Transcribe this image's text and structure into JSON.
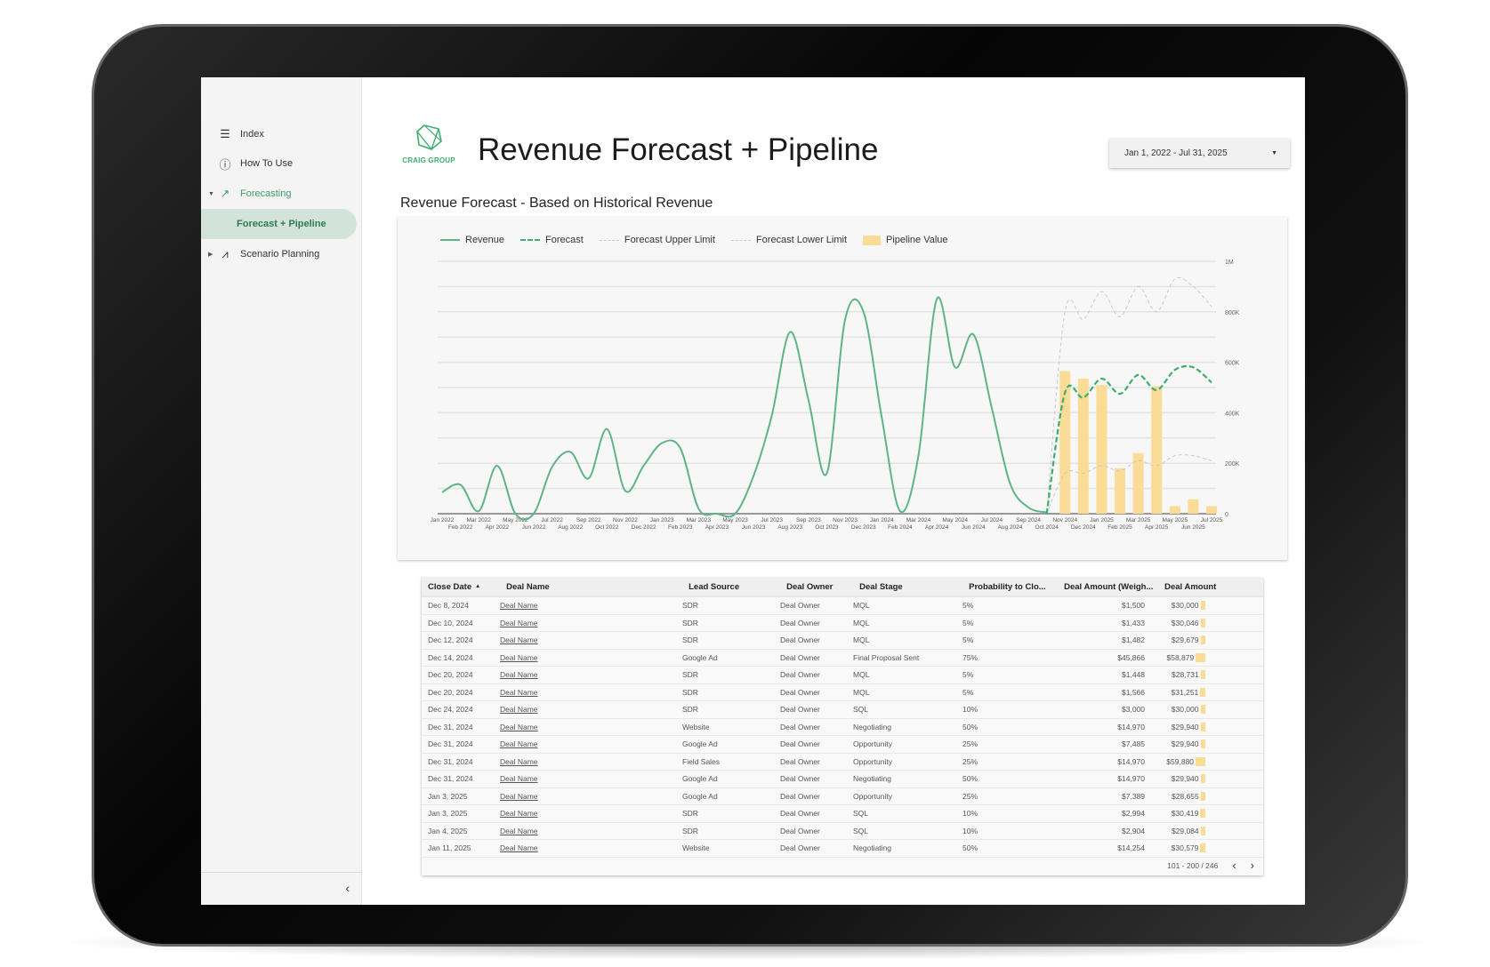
{
  "sidebar": {
    "items": [
      {
        "label": "Index",
        "icon": "list-icon"
      },
      {
        "label": "How To Use",
        "icon": "info-icon"
      },
      {
        "label": "Forecasting",
        "icon": "trending-up-icon",
        "expanded": true
      },
      {
        "label": "Forecast + Pipeline",
        "active": true
      },
      {
        "label": "Scenario Planning",
        "icon": "scatter-trend-icon",
        "expanded": false
      }
    ],
    "collapse_icon": "chevron-left-icon"
  },
  "header": {
    "logo_text": "CRAIG GROUP",
    "title": "Revenue Forecast + Pipeline",
    "date_range": "Jan 1, 2022 - Jul 31, 2025"
  },
  "colors": {
    "revenue": "#5fb487",
    "forecast": "#3fae6c",
    "limits": "#c8c8c8",
    "pipeline": "#fbdc97",
    "active_nav": "#d2e3d9"
  },
  "chart_data": {
    "type": "line",
    "title": "Revenue Forecast - Based on Historical Revenue",
    "legend_position": "top-left",
    "grid": true,
    "ylim": [
      0,
      1000000
    ],
    "yticks": [
      "0",
      "200K",
      "400K",
      "600K",
      "800K",
      "1M"
    ],
    "ytick_values": [
      0,
      200000,
      400000,
      600000,
      800000,
      1000000
    ],
    "categories": [
      "Jan 2022",
      "Feb 2022",
      "Mar 2022",
      "Apr 2022",
      "May 2022",
      "Jun 2022",
      "Jul 2022",
      "Aug 2022",
      "Sep 2022",
      "Oct 2022",
      "Nov 2022",
      "Dec 2022",
      "Jan 2023",
      "Feb 2023",
      "Mar 2023",
      "Apr 2023",
      "May 2023",
      "Jun 2023",
      "Jul 2023",
      "Aug 2023",
      "Sep 2023",
      "Oct 2023",
      "Nov 2023",
      "Dec 2023",
      "Jan 2024",
      "Feb 2024",
      "Mar 2024",
      "Apr 2024",
      "May 2024",
      "Jun 2024",
      "Jul 2024",
      "Aug 2024",
      "Sep 2024",
      "Oct 2024",
      "Nov 2024",
      "Dec 2024",
      "Jan 2025",
      "Feb 2025",
      "Mar 2025",
      "Apr 2025",
      "May 2025",
      "Jun 2025",
      "Jul 2025"
    ],
    "series": [
      {
        "name": "Revenue",
        "style": "solid",
        "values": [
          85000,
          115000,
          10000,
          190000,
          0,
          0,
          185000,
          245000,
          140000,
          335000,
          90000,
          190000,
          280000,
          260000,
          20000,
          0,
          0,
          150000,
          390000,
          720000,
          450000,
          160000,
          770000,
          800000,
          380000,
          10000,
          230000,
          850000,
          580000,
          710000,
          420000,
          120000,
          25000,
          5000,
          null,
          null,
          null,
          null,
          null,
          null,
          null,
          null,
          null
        ]
      },
      {
        "name": "Forecast",
        "style": "dashed",
        "values": [
          null,
          null,
          null,
          null,
          null,
          null,
          null,
          null,
          null,
          null,
          null,
          null,
          null,
          null,
          null,
          null,
          null,
          null,
          null,
          null,
          null,
          null,
          null,
          null,
          null,
          null,
          null,
          null,
          null,
          null,
          null,
          null,
          null,
          0,
          480000,
          460000,
          535000,
          475000,
          550000,
          490000,
          570000,
          580000,
          520000
        ]
      },
      {
        "name": "Forecast Upper Limit",
        "style": "dashed-gray",
        "values": [
          null,
          null,
          null,
          null,
          null,
          null,
          null,
          null,
          null,
          null,
          null,
          null,
          null,
          null,
          null,
          null,
          null,
          null,
          null,
          null,
          null,
          null,
          null,
          null,
          null,
          null,
          null,
          null,
          null,
          null,
          null,
          null,
          null,
          0,
          800000,
          770000,
          880000,
          780000,
          900000,
          800000,
          930000,
          900000,
          820000
        ]
      },
      {
        "name": "Forecast Lower Limit",
        "style": "dashed-gray",
        "values": [
          null,
          null,
          null,
          null,
          null,
          null,
          null,
          null,
          null,
          null,
          null,
          null,
          null,
          null,
          null,
          null,
          null,
          null,
          null,
          null,
          null,
          null,
          null,
          null,
          null,
          null,
          null,
          null,
          null,
          null,
          null,
          null,
          null,
          0,
          160000,
          160000,
          190000,
          170000,
          210000,
          190000,
          230000,
          230000,
          210000
        ]
      },
      {
        "name": "Pipeline Value",
        "style": "bar",
        "values": [
          null,
          null,
          null,
          null,
          null,
          null,
          null,
          null,
          null,
          null,
          null,
          null,
          null,
          null,
          null,
          null,
          null,
          null,
          null,
          null,
          null,
          null,
          null,
          null,
          null,
          null,
          null,
          null,
          null,
          null,
          null,
          null,
          null,
          null,
          565000,
          535000,
          510000,
          180000,
          240000,
          505000,
          30000,
          57000,
          30000
        ]
      }
    ]
  },
  "table": {
    "columns": [
      "Close Date",
      "Deal Name",
      "Lead Source",
      "Deal Owner",
      "Deal Stage",
      "Probability to Clo...",
      "Deal Amount (Weigh...",
      "Deal Amount"
    ],
    "sort_indicator": "▲",
    "rows": [
      [
        "Dec 8, 2024",
        "Deal Name",
        "SDR",
        "Deal Owner",
        "MQL",
        "5%",
        "$1,500",
        "$30,000"
      ],
      [
        "Dec 10, 2024",
        "Deal Name",
        "SDR",
        "Deal Owner",
        "MQL",
        "5%",
        "$1,433",
        "$30,046"
      ],
      [
        "Dec 12, 2024",
        "Deal Name",
        "SDR",
        "Deal Owner",
        "MQL",
        "5%",
        "$1,482",
        "$29,679"
      ],
      [
        "Dec 14, 2024",
        "Deal Name",
        "Google Ad",
        "Deal Owner",
        "Final Proposal Sent",
        "75%",
        "$45,866",
        "$58,879"
      ],
      [
        "Dec 20, 2024",
        "Deal Name",
        "SDR",
        "Deal Owner",
        "MQL",
        "5%",
        "$1,448",
        "$28,731"
      ],
      [
        "Dec 20, 2024",
        "Deal Name",
        "SDR",
        "Deal Owner",
        "MQL",
        "5%",
        "$1,566",
        "$31,251"
      ],
      [
        "Dec 24, 2024",
        "Deal Name",
        "SDR",
        "Deal Owner",
        "SQL",
        "10%",
        "$3,000",
        "$30,000"
      ],
      [
        "Dec 31, 2024",
        "Deal Name",
        "Website",
        "Deal Owner",
        "Negotiating",
        "50%",
        "$14,970",
        "$29,940"
      ],
      [
        "Dec 31, 2024",
        "Deal Name",
        "Google Ad",
        "Deal Owner",
        "Opportunity",
        "25%",
        "$7,485",
        "$29,940"
      ],
      [
        "Dec 31, 2024",
        "Deal Name",
        "Field Sales",
        "Deal Owner",
        "Opportunity",
        "25%",
        "$14,970",
        "$59,880"
      ],
      [
        "Dec 31, 2024",
        "Deal Name",
        "Google Ad",
        "Deal Owner",
        "Negotiating",
        "50%",
        "$14,970",
        "$29,940"
      ],
      [
        "Jan 3, 2025",
        "Deal Name",
        "Google Ad",
        "Deal Owner",
        "Opportunity",
        "25%",
        "$7,389",
        "$28,655"
      ],
      [
        "Jan 3, 2025",
        "Deal Name",
        "SDR",
        "Deal Owner",
        "SQL",
        "10%",
        "$2,994",
        "$30,419"
      ],
      [
        "Jan 4, 2025",
        "Deal Name",
        "SDR",
        "Deal Owner",
        "SQL",
        "10%",
        "$2,904",
        "$29,084"
      ],
      [
        "Jan 11, 2025",
        "Deal Name",
        "Website",
        "Deal Owner",
        "Negotiating",
        "50%",
        "$14,254",
        "$30,579"
      ]
    ],
    "pagination": "101 - 200 / 246"
  }
}
